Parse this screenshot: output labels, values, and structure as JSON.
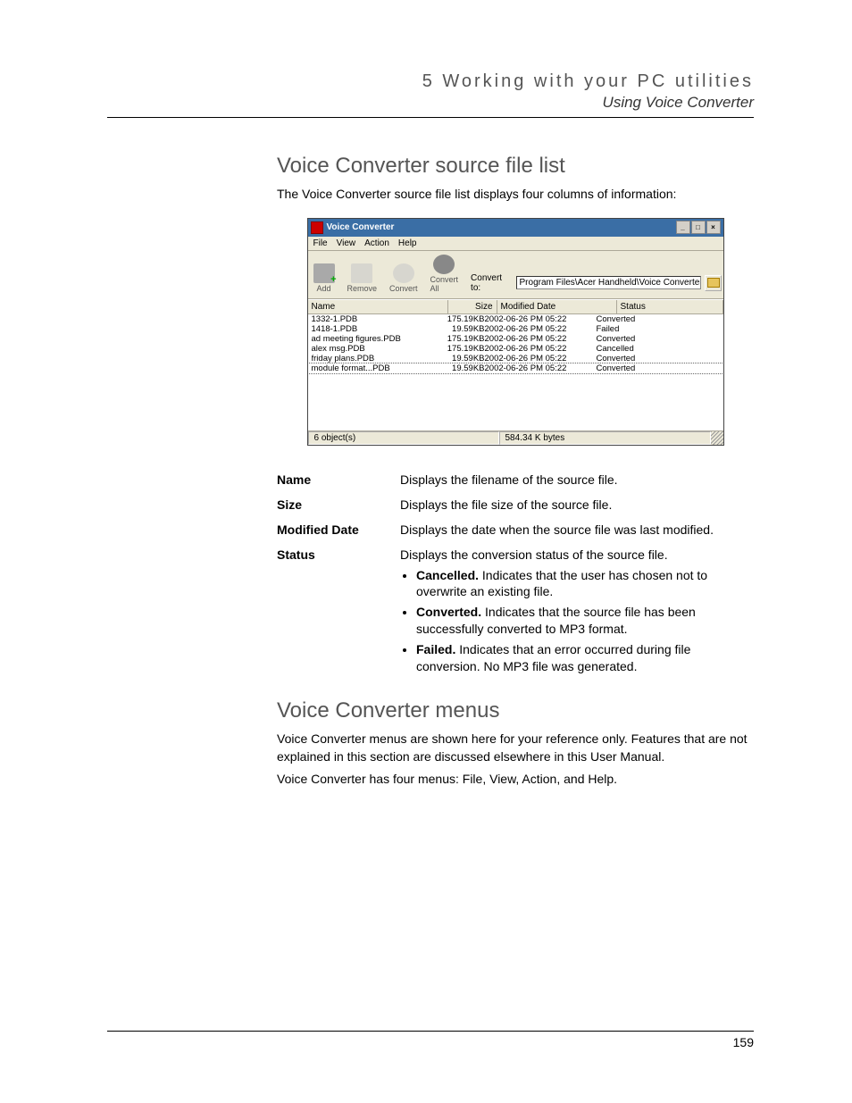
{
  "header": {
    "chapter": "5 Working with your PC utilities",
    "section": "Using Voice Converter"
  },
  "section1": {
    "heading": "Voice Converter source file list",
    "intro": "The Voice Converter source file list displays four columns of information:"
  },
  "screenshot": {
    "title": "Voice Converter",
    "menus": [
      "File",
      "View",
      "Action",
      "Help"
    ],
    "toolbar": {
      "add": "Add",
      "remove": "Remove",
      "convert": "Convert",
      "convert_all": "Convert All",
      "convert_to_label": "Convert to:",
      "path": "Program Files\\Acer Handheld\\Voice Converter"
    },
    "columns": {
      "name": "Name",
      "size": "Size",
      "date": "Modified Date",
      "status": "Status"
    },
    "rows": [
      {
        "name": "1332-1.PDB",
        "size": "175.19KB",
        "date": "2002-06-26 PM 05:22",
        "status": "Converted"
      },
      {
        "name": "1418-1.PDB",
        "size": "19.59KB",
        "date": "2002-06-26 PM 05:22",
        "status": "Failed"
      },
      {
        "name": "ad meeting figures.PDB",
        "size": "175.19KB",
        "date": "2002-06-26 PM 05:22",
        "status": "Converted"
      },
      {
        "name": "alex msg.PDB",
        "size": "175.19KB",
        "date": "2002-06-26 PM 05:22",
        "status": "Cancelled"
      },
      {
        "name": "friday plans.PDB",
        "size": "19.59KB",
        "date": "2002-06-26 PM 05:22",
        "status": "Converted"
      },
      {
        "name": "module format...PDB",
        "size": "19.59KB",
        "date": "2002-06-26 PM 05:22",
        "status": "Converted"
      }
    ],
    "status_objects": "6 object(s)",
    "status_size": "584.34 K bytes"
  },
  "defs": {
    "name_term": "Name",
    "name_desc": "Displays the filename of the source file.",
    "size_term": "Size",
    "size_desc": "Displays the file size of the source file.",
    "date_term": "Modified Date",
    "date_desc": "Displays the date when the source file was last modified.",
    "status_term": "Status",
    "status_desc": "Displays the conversion status of the source file.",
    "bullets": {
      "cancelled_label": "Cancelled.",
      "cancelled_text": " Indicates that the user has chosen not to overwrite an existing file.",
      "converted_label": "Converted.",
      "converted_text": " Indicates that the source file has been successfully converted to MP3 format.",
      "failed_label": "Failed.",
      "failed_text": " Indicates that an error occurred during file conversion. No MP3 file was generated."
    }
  },
  "section2": {
    "heading": "Voice Converter menus",
    "p1": "Voice Converter menus are shown here for your reference only. Features that are not explained in this section are discussed elsewhere in this User Manual.",
    "p2": "Voice Converter has four menus: File, View, Action, and Help."
  },
  "page_number": "159"
}
